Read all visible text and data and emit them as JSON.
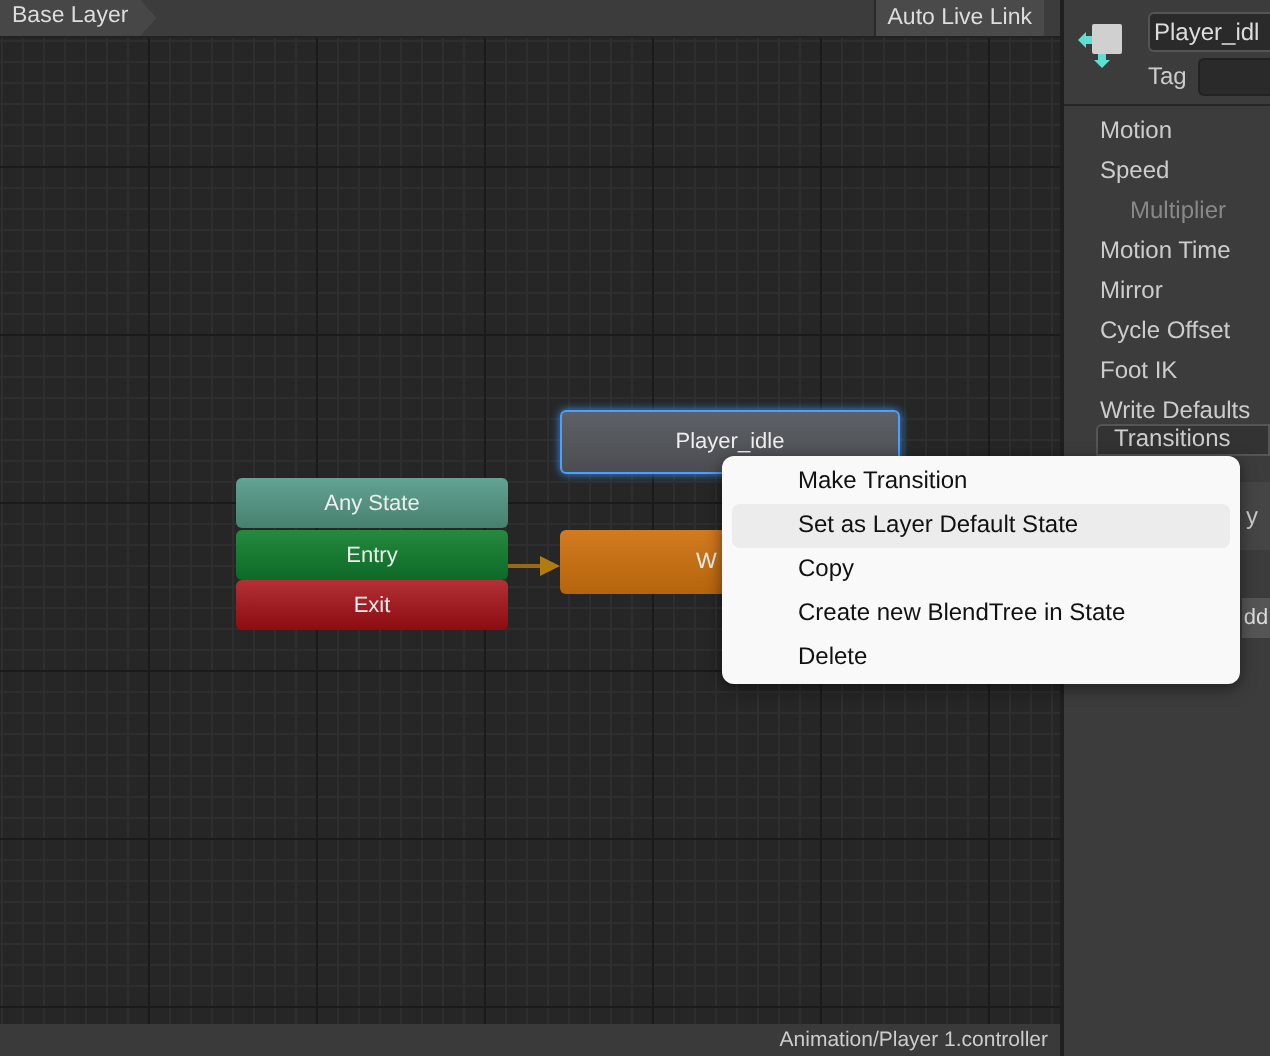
{
  "toolbar": {
    "breadcrumb": "Base Layer",
    "live_link_button": "Auto Live Link"
  },
  "graph": {
    "nodes": [
      {
        "label": "Player_idle",
        "kind": "state",
        "selected": true
      },
      {
        "label": "Any State",
        "kind": "any",
        "selected": false
      },
      {
        "label": "Entry",
        "kind": "entry",
        "selected": false
      },
      {
        "label": "Exit",
        "kind": "exit",
        "selected": false
      },
      {
        "label": "W",
        "kind": "default",
        "selected": false
      }
    ]
  },
  "context_menu": [
    {
      "label": "Make Transition",
      "highlighted": false
    },
    {
      "label": "Set as Layer Default State",
      "highlighted": true
    },
    {
      "label": "Copy",
      "highlighted": false
    },
    {
      "label": "Create new BlendTree in State",
      "highlighted": false
    },
    {
      "label": "Delete",
      "highlighted": false
    }
  ],
  "status_bar": "Animation/Player 1.controller",
  "inspector": {
    "name_field": "Player_idl",
    "tag_label": "Tag",
    "properties": [
      {
        "label": "Motion",
        "disabled": false
      },
      {
        "label": "Speed",
        "disabled": false
      },
      {
        "label": "Multiplier",
        "disabled": true
      },
      {
        "label": "Motion Time",
        "disabled": false
      },
      {
        "label": "Mirror",
        "disabled": false
      },
      {
        "label": "Cycle Offset",
        "disabled": false
      },
      {
        "label": "Foot IK",
        "disabled": false
      },
      {
        "label": "Write Defaults",
        "disabled": false
      }
    ],
    "transitions_header": "Transitions",
    "row_fragment": "y",
    "add_button": "dd"
  }
}
